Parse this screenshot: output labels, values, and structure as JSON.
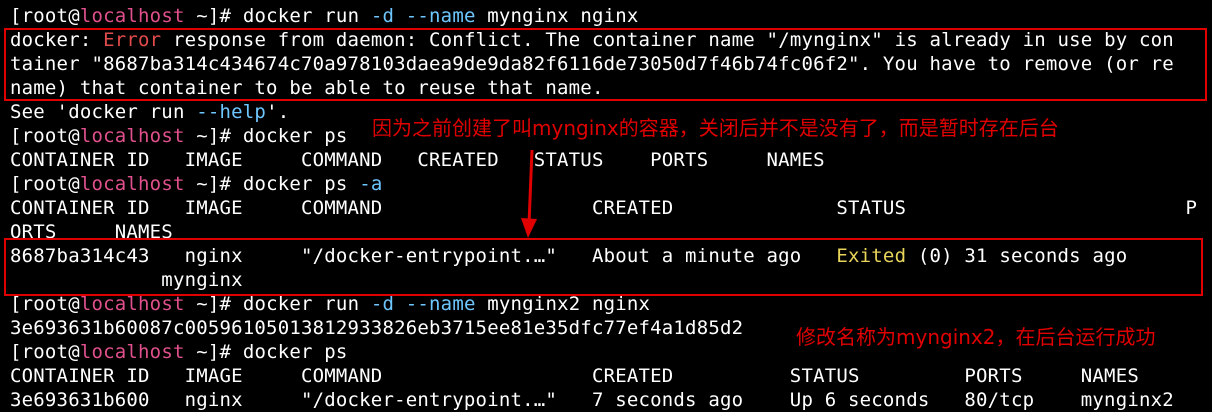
{
  "terminal": {
    "prompt_user": "[root@",
    "prompt_host": "localhost",
    "prompt_tail": " ~]# ",
    "lines": {
      "cmd1_pre": "docker run ",
      "cmd1_flag1": "-d",
      "cmd1_mid": " ",
      "cmd1_flag2": "--name",
      "cmd1_post": " mynginx nginx",
      "err1_pre": "docker: ",
      "err1_word": "Error",
      "err1_post": " response from daemon: Conflict. The container name \"/mynginx\" is already in use by con",
      "err2": "tainer \"8687ba314c434674c70a978103daea9de9da82f6116de73050d7f46b74fc06f2\". You have to remove (or re",
      "err3": "name) that container to be able to reuse that name.",
      "see_pre": "See 'docker run ",
      "see_flag": "--help",
      "see_post": "'.",
      "cmd2": "docker ps",
      "hdr1": "CONTAINER ID   IMAGE     COMMAND   CREATED   STATUS    PORTS     NAMES",
      "cmd3_pre": "docker ps ",
      "cmd3_flag": "-a",
      "hdr2": "CONTAINER ID   IMAGE     COMMAND                  CREATED              STATUS                        P",
      "hdr2b": "ORTS     NAMES",
      "row1_pre": "8687ba314c43   nginx     \"/docker-entrypoint.…\"   About a minute ago   ",
      "row1_status": "Exited",
      "row1_post": " (0) 31 seconds ago",
      "row1b": "             mynginx",
      "cmd4_pre": "docker run ",
      "cmd4_flag1": "-d",
      "cmd4_mid": " ",
      "cmd4_flag2": "--name",
      "cmd4_post": " mynginx2 nginx",
      "hash": "3e693631b60087c00596105013812933826eb3715ee81e35dfc77ef4a1d85d2",
      "cmd5": "docker ps",
      "hdr3": "CONTAINER ID   IMAGE     COMMAND                  CREATED          STATUS         PORTS     NAMES",
      "row2": "3e693631b600   nginx     \"/docker-entrypoint.…\"   7 seconds ago    Up 6 seconds   80/tcp    mynginx2"
    }
  },
  "annotations": {
    "note1": "因为之前创建了叫mynginx的容器，关闭后并不是没有了，而是暂时存在后台",
    "note2": "修改名称为mynginx2，在后台运行成功"
  },
  "colors": {
    "background": "#000000",
    "annotation": "#e00000",
    "host": "#e0508c",
    "flag": "#6ec7ff",
    "exited": "#e8d55a"
  }
}
